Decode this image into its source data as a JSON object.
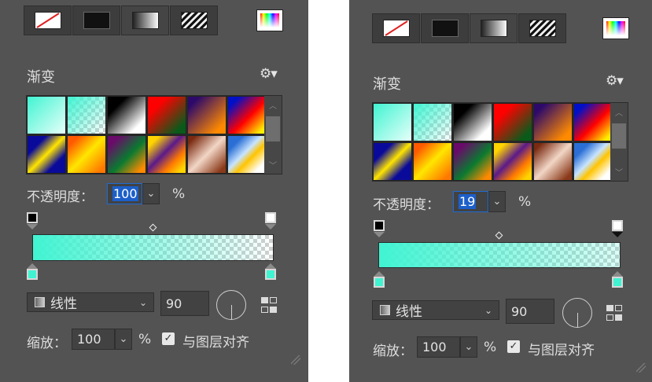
{
  "colors": {
    "panel_bg": "#535353",
    "accent": "#1e6bd6",
    "gradient_color": "#40f4d2"
  },
  "icons": {
    "fill_types": [
      "no-fill-icon",
      "solid-fill-icon",
      "gradient-fill-icon",
      "pattern-fill-icon"
    ],
    "color_picker": "color-picker-icon",
    "settings": "gear-icon",
    "align_layer": "align-icon",
    "angle": "angle-dial-icon",
    "resize": "resize-grip-icon"
  },
  "presets": [
    {
      "name": "aqua-white",
      "css": "linear-gradient(135deg,#40f4d2 0%,#e6fff9 100%)"
    },
    {
      "name": "aqua-transparent",
      "css": "linear-gradient(135deg,#40f4d2 0%,rgba(64,244,210,0) 100%)"
    },
    {
      "name": "black-white",
      "css": "linear-gradient(135deg,#000 25%,#fff 80%)"
    },
    {
      "name": "red-green",
      "css": "linear-gradient(135deg,#ff0000 25%,#0a5a1a 85%)"
    },
    {
      "name": "violet-orange",
      "css": "linear-gradient(135deg,#2d0a6a 15%,#ff8a00 85%)"
    },
    {
      "name": "blue-red-yellow",
      "css": "linear-gradient(135deg,#0010c8 15%,#ff0000 55%,#ffee00 90%)"
    },
    {
      "name": "blue-yellow-blue",
      "css": "linear-gradient(135deg,#0a0a9a 25%,#ffe500 50%,#0a0a9a 75%)"
    },
    {
      "name": "orange-yellow-orange",
      "css": "linear-gradient(135deg,#ff5a00 15%,#ffe600 50%,#ff7800 90%)"
    },
    {
      "name": "violet-green-orange",
      "css": "linear-gradient(135deg,#6a0a6a 15%,#0a7a30 55%,#ff8a00 90%)"
    },
    {
      "name": "yellow-violet-orange",
      "css": "linear-gradient(135deg,#ffd400 15%,#5a1a8a 45%,#ff7a00 70%,#ffd400 90%)"
    },
    {
      "name": "copper",
      "css": "linear-gradient(135deg,#7a2a10 10%,#f2d6c6 50%,#8a3a1a 90%)"
    },
    {
      "name": "chrome",
      "css": "linear-gradient(135deg,#2b6fd6 20%,#c8e4ff 45%,#ffc400 60%,#fff 85%)"
    }
  ],
  "panels": [
    {
      "title": "渐变",
      "opacity_label": "不透明度：",
      "opacity_value": "100",
      "opacity_unit": "%",
      "opacity_fraction": 1.0,
      "style_value": "线性",
      "angle_value": "90",
      "scale_label": "缩放：",
      "scale_value": "100",
      "scale_unit": "%",
      "align_label": "与图层对齐",
      "align_checked": "✓",
      "dropdown_arrow": "⌄"
    },
    {
      "title": "渐变",
      "opacity_label": "不透明度：",
      "opacity_value": "19",
      "opacity_unit": "%",
      "opacity_fraction": 0.19,
      "style_value": "线性",
      "angle_value": "90",
      "scale_label": "缩放：",
      "scale_value": "100",
      "scale_unit": "%",
      "align_label": "与图层对齐",
      "align_checked": "✓",
      "dropdown_arrow": "⌄"
    }
  ]
}
